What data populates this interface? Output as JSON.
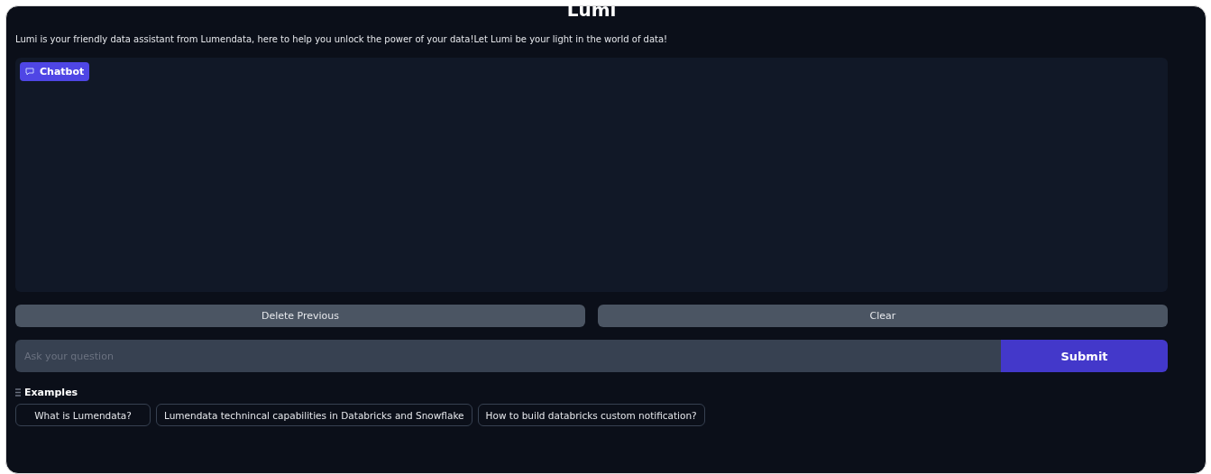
{
  "title": "Lumi",
  "description": "Lumi is your friendly data assistant from Lumendata, here to help you unlock the power of your data!Let Lumi be your light in the world of data!",
  "chatbot": {
    "label": "Chatbot"
  },
  "actions": [
    "Delete Previous",
    "Clear"
  ],
  "question": {
    "placeholder": "Ask your question",
    "submit": "Submit"
  },
  "examples": {
    "label": "Examples",
    "items": [
      "What is Lumendata?",
      "Lumendata technincal capabilities in Databricks and Snowflake",
      "How to build databricks custom notification?"
    ]
  }
}
